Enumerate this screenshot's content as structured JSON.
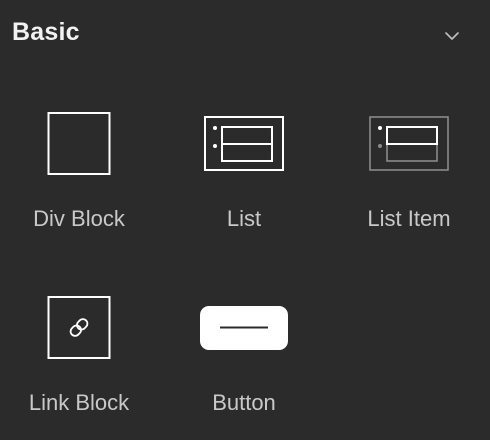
{
  "section": {
    "title": "Basic",
    "collapse_icon": "chevron-down-icon"
  },
  "elements": [
    {
      "label": "Div Block",
      "icon": "div-block-icon"
    },
    {
      "label": "List",
      "icon": "list-icon"
    },
    {
      "label": "List Item",
      "icon": "list-item-icon"
    },
    {
      "label": "Link Block",
      "icon": "link-block-icon"
    },
    {
      "label": "Button",
      "icon": "button-icon"
    }
  ],
  "colors": {
    "background": "#2b2b2b",
    "label": "#c9c9c9",
    "title": "#f2f2f2",
    "icon_stroke": "#ffffff",
    "icon_muted": "#8a8a8a"
  }
}
